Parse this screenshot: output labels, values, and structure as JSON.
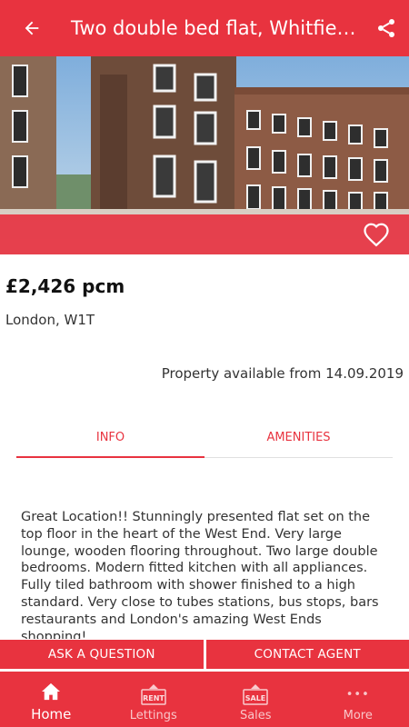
{
  "header": {
    "title": "Two double bed flat, Whitfield Street",
    "back_icon": "arrow-left-icon",
    "share_icon": "share-icon"
  },
  "hero": {
    "favorite_icon": "heart-outline-icon"
  },
  "listing": {
    "price": "£2,426 pcm",
    "location": "London, W1T",
    "availability": "Property available from 14.09.2019"
  },
  "tabs": [
    {
      "label": "INFO",
      "active": true
    },
    {
      "label": "AMENITIES",
      "active": false
    }
  ],
  "description": "Great Location!! Stunningly presented flat set on the top floor in the heart of the West End. Very large lounge, wooden flooring throughout. Two large double bedrooms. Modern fitted kitchen with all appliances. Fully tiled bathroom with shower finished to a high standard. Very close to tubes stations, bus stops, bars restaurants and London's amazing West Ends shopping!",
  "actions": {
    "ask": "ASK A QUESTION",
    "contact": "CONTACT AGENT"
  },
  "nav": [
    {
      "label": "Home",
      "icon": "home-icon",
      "active": true
    },
    {
      "label": "Lettings",
      "icon": "rent-sign-icon",
      "badge": "RENT",
      "active": false
    },
    {
      "label": "Sales",
      "icon": "sale-sign-icon",
      "badge": "SALE",
      "active": false
    },
    {
      "label": "More",
      "icon": "more-dots-icon",
      "badge": "•••",
      "active": false
    }
  ],
  "colors": {
    "primary": "#e8333f",
    "text": "#333333"
  }
}
